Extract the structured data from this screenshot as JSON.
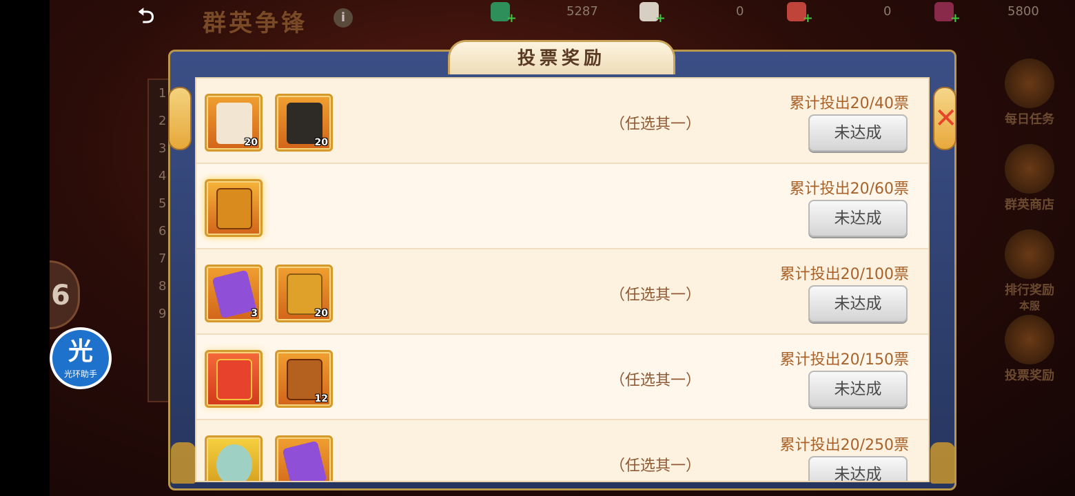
{
  "header": {
    "back_label": "⮌",
    "title": "群英争锋",
    "info_label": "i",
    "currencies": [
      {
        "icon": "jade-token-icon",
        "value": "5287",
        "color": "#2f8f5a"
      },
      {
        "icon": "silver-scroll-icon",
        "value": "0",
        "color": "#d8cfc4"
      },
      {
        "icon": "red-scroll-icon",
        "value": "0",
        "color": "#c0443a"
      },
      {
        "icon": "mask-icon",
        "value": "5800",
        "color": "#8a2a4a"
      }
    ]
  },
  "side_menu": {
    "items": [
      {
        "label": "每日任务",
        "icon": "scroll-task-icon"
      },
      {
        "label": "群英商店",
        "icon": "shop-pavilion-icon"
      },
      {
        "label": "排行奖励",
        "icon": "ranking-gate-icon"
      },
      {
        "label": "投票奖励",
        "icon": "gold-ingot-icon"
      }
    ],
    "ranking_sub": "本服"
  },
  "left_panel": {
    "ranks": [
      "1",
      "2",
      "3",
      "4",
      "5",
      "6",
      "7",
      "8",
      "9"
    ]
  },
  "float_button": {
    "big": "光",
    "small": "光环助手"
  },
  "half_circle": {
    "label": "6"
  },
  "modal": {
    "title": "投票奖励",
    "close_label": "✕",
    "rows": [
      {
        "items": [
          {
            "icon": "white-scroll-icon",
            "qty": "20",
            "color": "#f2e6d2"
          },
          {
            "icon": "black-scroll-icon",
            "qty": "20",
            "color": "#2e2a26"
          }
        ],
        "choose": "（任选其一）",
        "requirement": "累计投出20/40票",
        "button": "未达成"
      },
      {
        "items": [
          {
            "icon": "golden-chest-icon",
            "qty": "",
            "color": "#d98b1e"
          }
        ],
        "choose": "",
        "requirement": "累计投出20/60票",
        "button": "未达成"
      },
      {
        "items": [
          {
            "icon": "purple-crystal-icon",
            "qty": "3",
            "color": "#8f4fd6"
          },
          {
            "icon": "ornate-chest-icon",
            "qty": "20",
            "color": "#e0a12a"
          }
        ],
        "choose": "（任选其一）",
        "requirement": "累计投出20/100票",
        "button": "未达成"
      },
      {
        "items": [
          {
            "icon": "red-treasure-chest-icon",
            "qty": "",
            "color": "#e7432c"
          },
          {
            "icon": "bronze-chest-icon",
            "qty": "12",
            "color": "#b4601e"
          }
        ],
        "choose": "（任选其一）",
        "requirement": "累计投出20/150票",
        "button": "未达成"
      },
      {
        "items": [
          {
            "icon": "jade-pendant-icon",
            "qty": "",
            "color": "#9fd0c4"
          },
          {
            "icon": "purple-crystal-icon",
            "qty": "",
            "color": "#8f4fd6"
          }
        ],
        "choose": "（任选其一）",
        "requirement": "累计投出20/250票",
        "button": "未达成"
      }
    ]
  }
}
